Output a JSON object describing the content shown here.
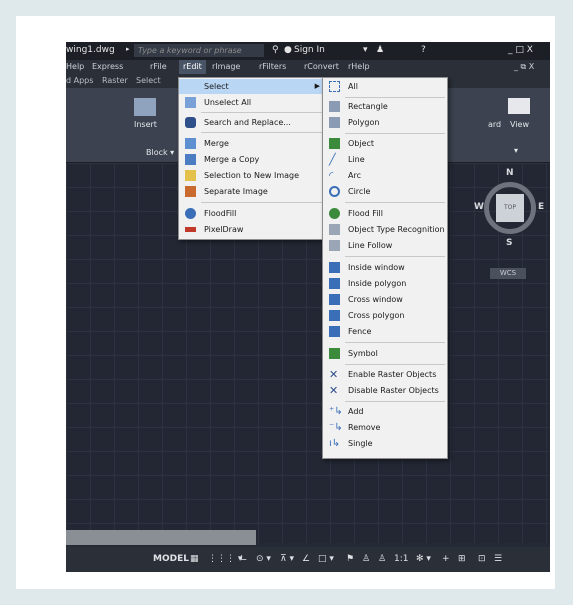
{
  "window": {
    "file_name": "wing1.dwg",
    "search_placeholder": "Type a keyword or phrase",
    "sign_in": "Sign In",
    "win_controls": "_ □ X",
    "doc_controls": "_ ⧉ X"
  },
  "menubar": {
    "items": [
      "Help",
      "Express",
      "rFile",
      "rEdit",
      "rImage",
      "rFilters",
      "rConvert",
      "rHelp"
    ]
  },
  "tabs": {
    "items": [
      "d Apps",
      "Raster",
      "Select"
    ]
  },
  "ribbon": {
    "insert_label": "Insert",
    "block_label": "Block ▾",
    "board_label": "ard",
    "view_label": "View"
  },
  "viewcube": {
    "north": "N",
    "south": "S",
    "west": "W",
    "east": "E",
    "top": "TOP",
    "wcs": "WCS"
  },
  "statusbar": {
    "model": "MODEL",
    "scale": "1:1"
  },
  "edit_menu": {
    "items": [
      {
        "label": "Select",
        "icon": "select-icon"
      },
      {
        "label": "Unselect All",
        "icon": "unselect-icon"
      },
      {
        "label": "Search and Replace...",
        "icon": "binoculars-icon"
      },
      {
        "label": "Merge",
        "icon": "merge-icon"
      },
      {
        "label": "Merge a Copy",
        "icon": "merge-copy-icon"
      },
      {
        "label": "Selection to New Image",
        "icon": "new-image-icon"
      },
      {
        "label": "Separate Image",
        "icon": "separate-icon"
      },
      {
        "label": "FloodFill",
        "icon": "floodfill-icon"
      },
      {
        "label": "PixelDraw",
        "icon": "pixeldraw-icon"
      }
    ]
  },
  "select_submenu": {
    "items": [
      {
        "label": "All",
        "icon": "select-all-icon"
      },
      {
        "label": "Rectangle",
        "icon": "rectangle-icon"
      },
      {
        "label": "Polygon",
        "icon": "polygon-icon"
      },
      {
        "label": "Object",
        "icon": "object-icon"
      },
      {
        "label": "Line",
        "icon": "line-icon"
      },
      {
        "label": "Arc",
        "icon": "arc-icon"
      },
      {
        "label": "Circle",
        "icon": "circle-icon"
      },
      {
        "label": "Flood Fill",
        "icon": "flood-fill-icon"
      },
      {
        "label": "Object Type Recognition",
        "icon": "recognition-icon"
      },
      {
        "label": "Line Follow",
        "icon": "line-follow-icon"
      },
      {
        "label": "Inside window",
        "icon": "inside-window-icon"
      },
      {
        "label": "Inside polygon",
        "icon": "inside-polygon-icon"
      },
      {
        "label": "Cross window",
        "icon": "cross-window-icon"
      },
      {
        "label": "Cross polygon",
        "icon": "cross-polygon-icon"
      },
      {
        "label": "Fence",
        "icon": "fence-icon"
      },
      {
        "label": "Symbol",
        "icon": "symbol-icon"
      },
      {
        "label": "Enable Raster Objects",
        "icon": "enable-icon"
      },
      {
        "label": "Disable Raster Objects",
        "icon": "disable-icon"
      },
      {
        "label": "Add",
        "icon": "add-icon"
      },
      {
        "label": "Remove",
        "icon": "remove-icon"
      },
      {
        "label": "Single",
        "icon": "single-icon"
      }
    ]
  },
  "colors": {
    "highlight": "#b9d6f4",
    "icon_blue": "#3a6fb8",
    "icon_green": "#3c8a3c",
    "icon_red": "#c0392b"
  }
}
